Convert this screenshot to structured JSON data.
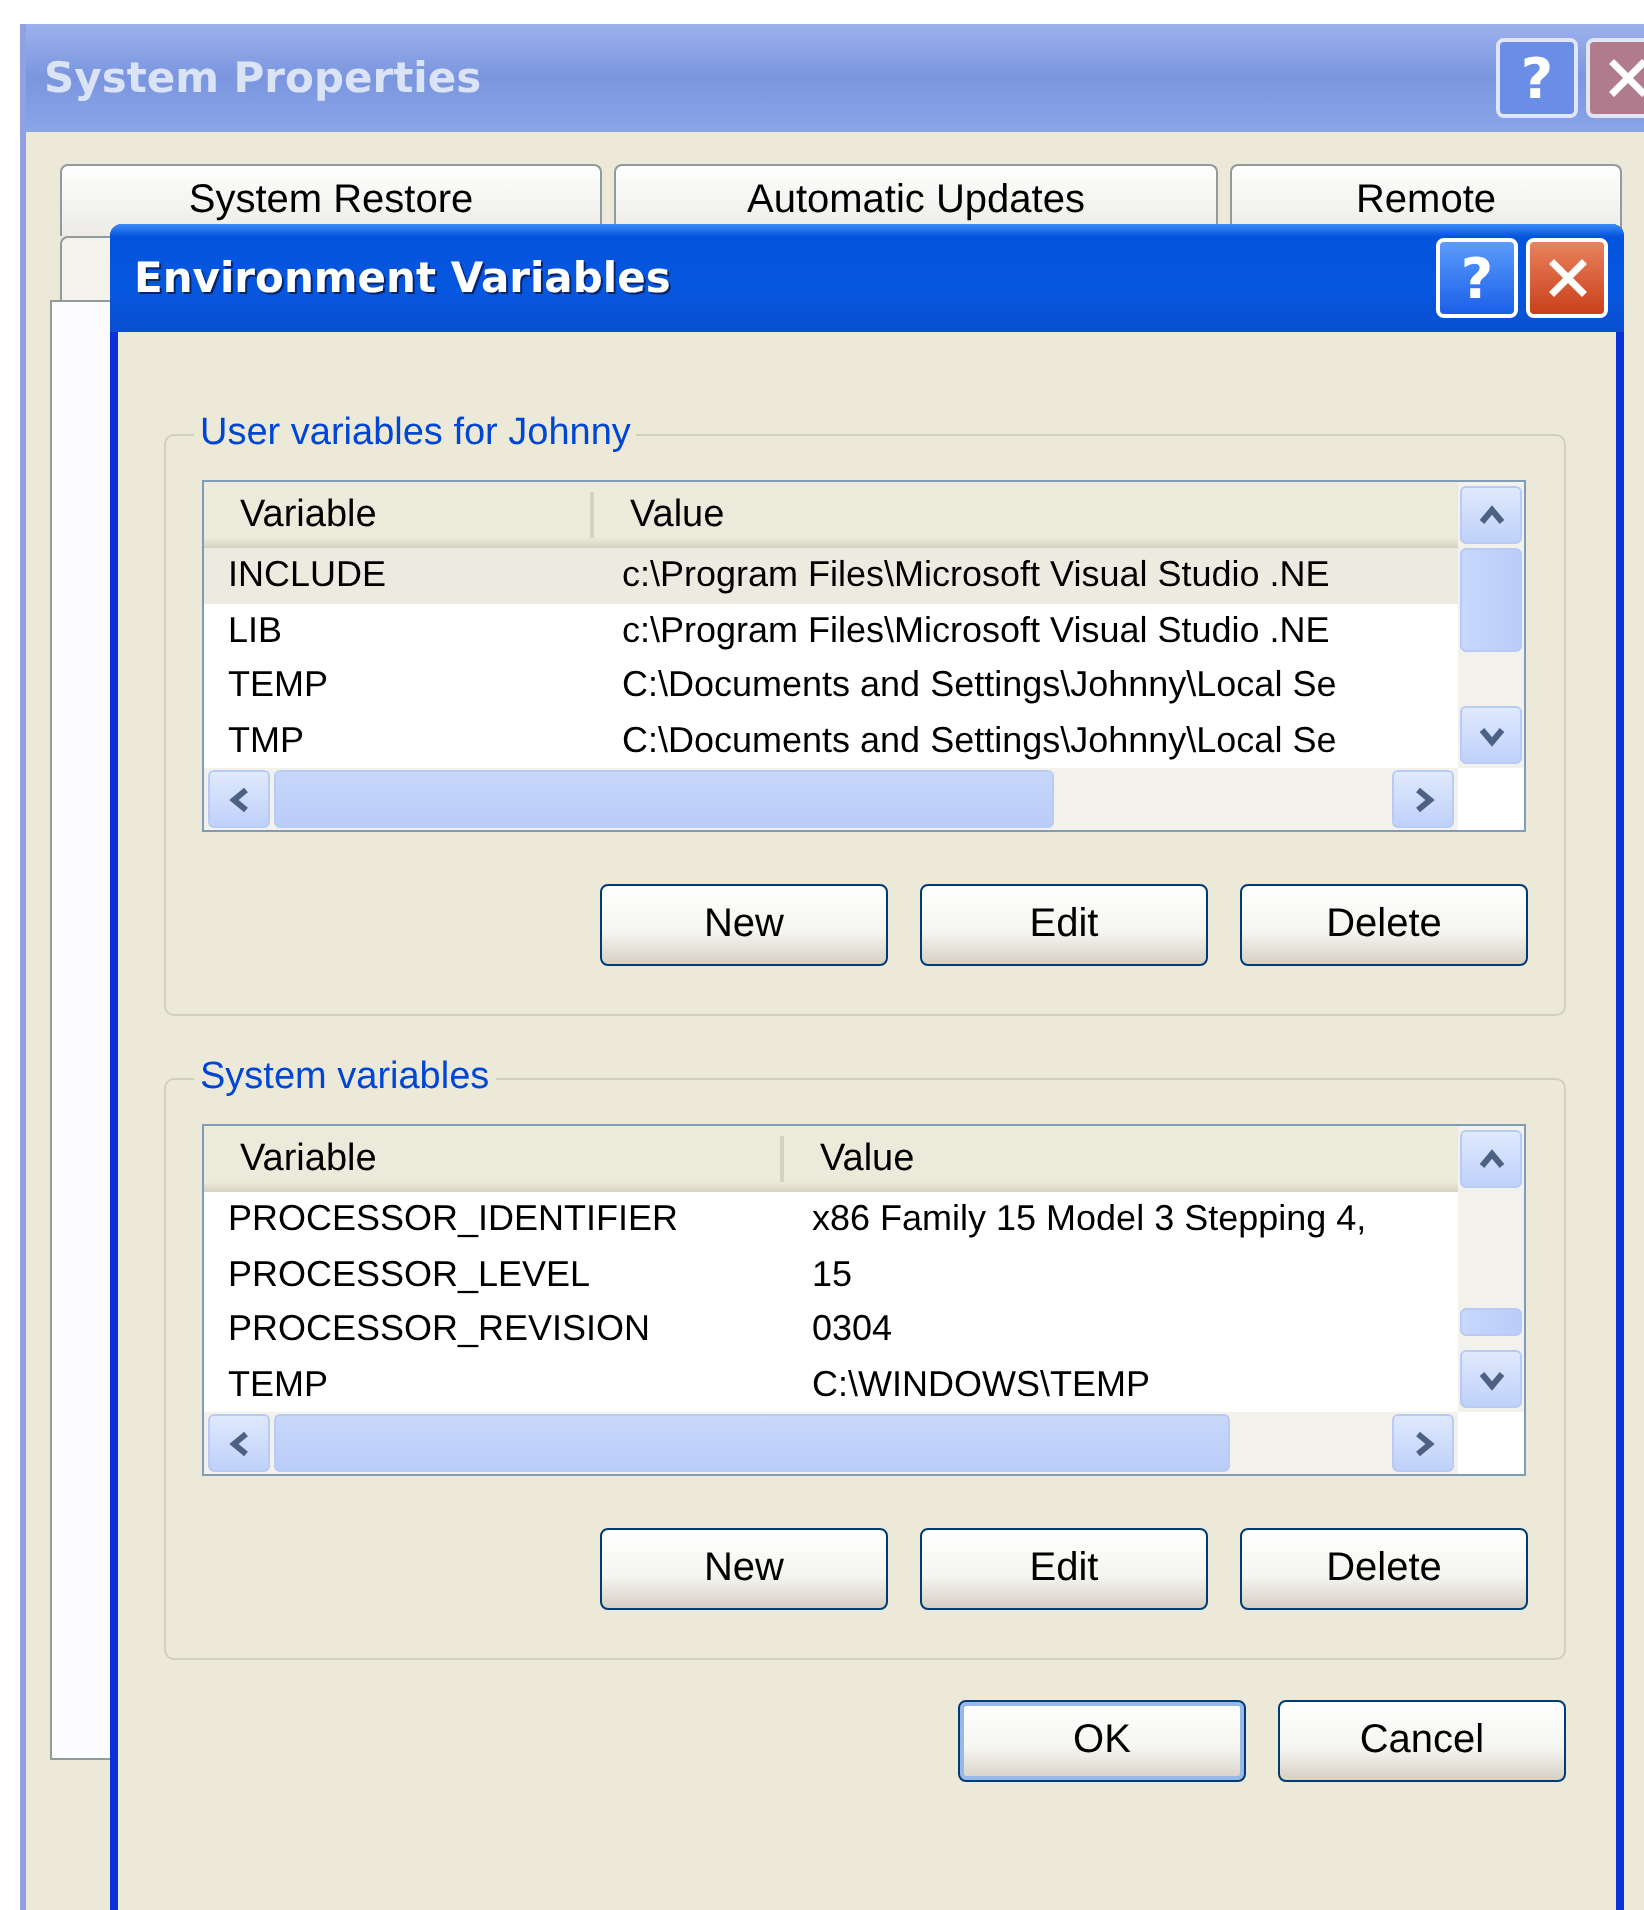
{
  "back_window": {
    "title": "System Properties",
    "active": false,
    "help": "?",
    "tabs": [
      {
        "label": "System Restore",
        "selected": false
      },
      {
        "label": "Automatic Updates",
        "selected": false
      },
      {
        "label": "Remote",
        "selected": false
      }
    ]
  },
  "dialog": {
    "title": "Environment Variables",
    "active": true,
    "help": "?",
    "groups": [
      {
        "title": "User variables for Johnny",
        "columns": [
          "Variable",
          "Value"
        ],
        "rows": [
          {
            "variable": "INCLUDE",
            "value": "c:\\Program Files\\Microsoft Visual Studio .NE",
            "selected": true
          },
          {
            "variable": "LIB",
            "value": "c:\\Program Files\\Microsoft Visual Studio .NE",
            "selected": false
          },
          {
            "variable": "TEMP",
            "value": "C:\\Documents and Settings\\Johnny\\Local Se",
            "selected": false
          },
          {
            "variable": "TMP",
            "value": "C:\\Documents and Settings\\Johnny\\Local Se",
            "selected": false
          }
        ],
        "buttons": [
          {
            "label": "New",
            "default": false
          },
          {
            "label": "Edit",
            "default": false
          },
          {
            "label": "Delete",
            "default": false
          }
        ]
      },
      {
        "title": "System variables",
        "columns": [
          "Variable",
          "Value"
        ],
        "rows": [
          {
            "variable": "PROCESSOR_IDENTIFIER",
            "value": "x86 Family 15 Model 3 Stepping 4,",
            "selected": false
          },
          {
            "variable": "PROCESSOR_LEVEL",
            "value": "15",
            "selected": false
          },
          {
            "variable": "PROCESSOR_REVISION",
            "value": "0304",
            "selected": false
          },
          {
            "variable": "TEMP",
            "value": "C:\\WINDOWS\\TEMP",
            "selected": false
          }
        ],
        "buttons": [
          {
            "label": "New",
            "default": false
          },
          {
            "label": "Edit",
            "default": false
          },
          {
            "label": "Delete",
            "default": false
          }
        ]
      }
    ],
    "buttons": [
      {
        "label": "OK",
        "default": true
      },
      {
        "label": "Cancel",
        "default": false
      }
    ]
  }
}
